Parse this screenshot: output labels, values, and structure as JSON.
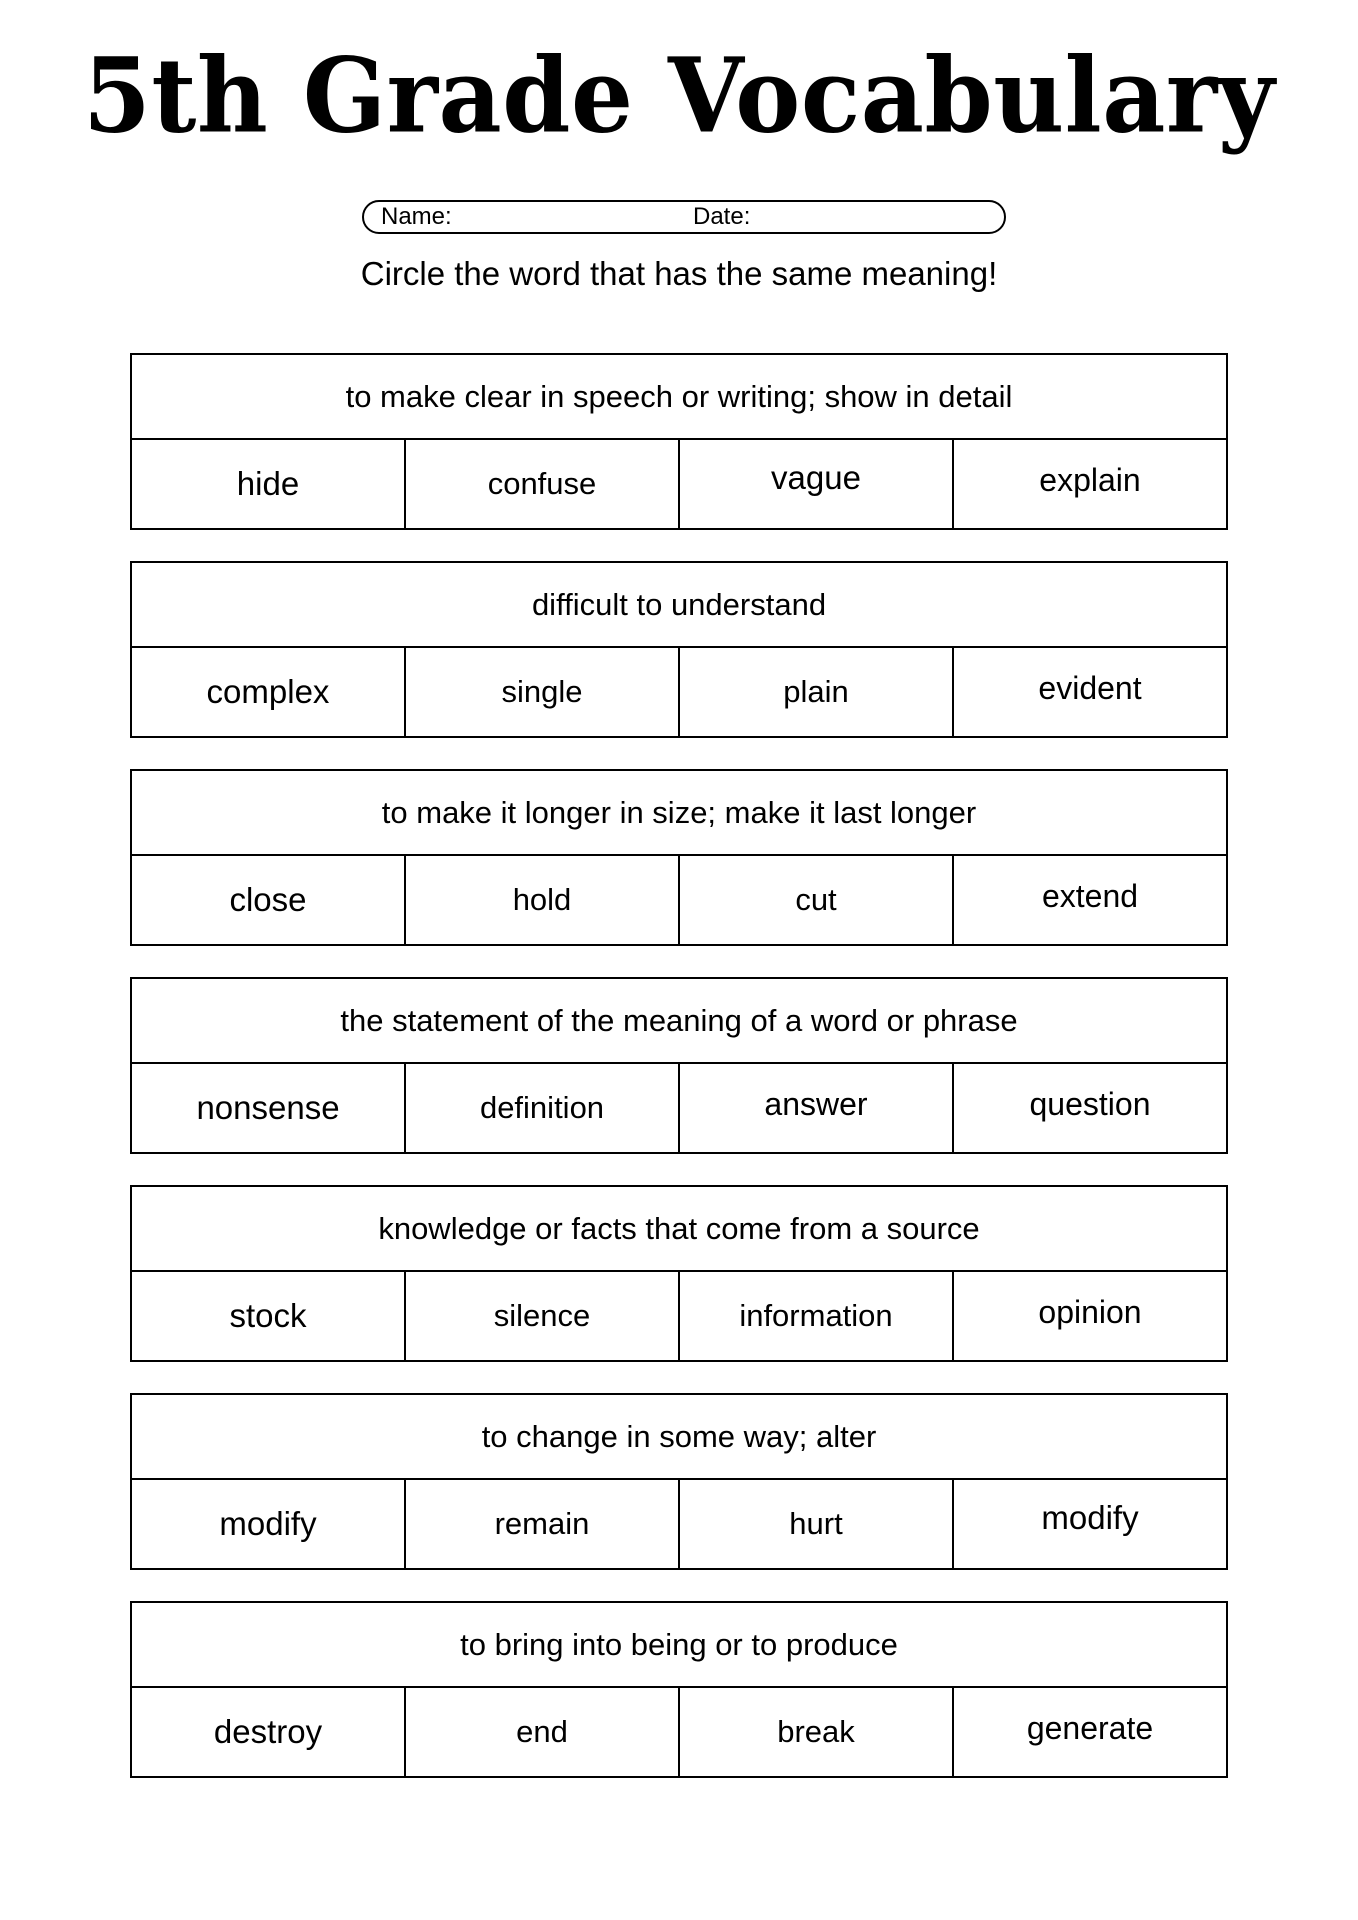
{
  "worksheet": {
    "title": "5th Grade Vocabulary",
    "name_label": "Name:",
    "date_label": "Date:",
    "instruction": "Circle the word that has the same meaning!",
    "colors": {
      "ink": "#000000",
      "paper": "#ffffff"
    }
  },
  "questions": [
    {
      "clue": "to make clear in speech or writing; show in detail",
      "options": [
        "hide",
        "confuse",
        "vague",
        "explain"
      ]
    },
    {
      "clue": "difficult to understand",
      "options": [
        "complex",
        "single",
        "plain",
        "evident"
      ]
    },
    {
      "clue": "to make it longer in size; make it last longer",
      "options": [
        "close",
        "hold",
        "cut",
        "extend"
      ]
    },
    {
      "clue": "the statement of the meaning of a word or phrase",
      "options": [
        "nonsense",
        "definition",
        "answer",
        "question"
      ]
    },
    {
      "clue": "knowledge or facts that come from a source",
      "options": [
        "stock",
        "silence",
        "information",
        "opinion"
      ]
    },
    {
      "clue": "to change in some way; alter",
      "options": [
        "modify",
        "remain",
        "hurt",
        "modify"
      ]
    },
    {
      "clue": "to bring into being or to produce",
      "options": [
        "destroy",
        "end",
        "break",
        "generate"
      ]
    }
  ]
}
